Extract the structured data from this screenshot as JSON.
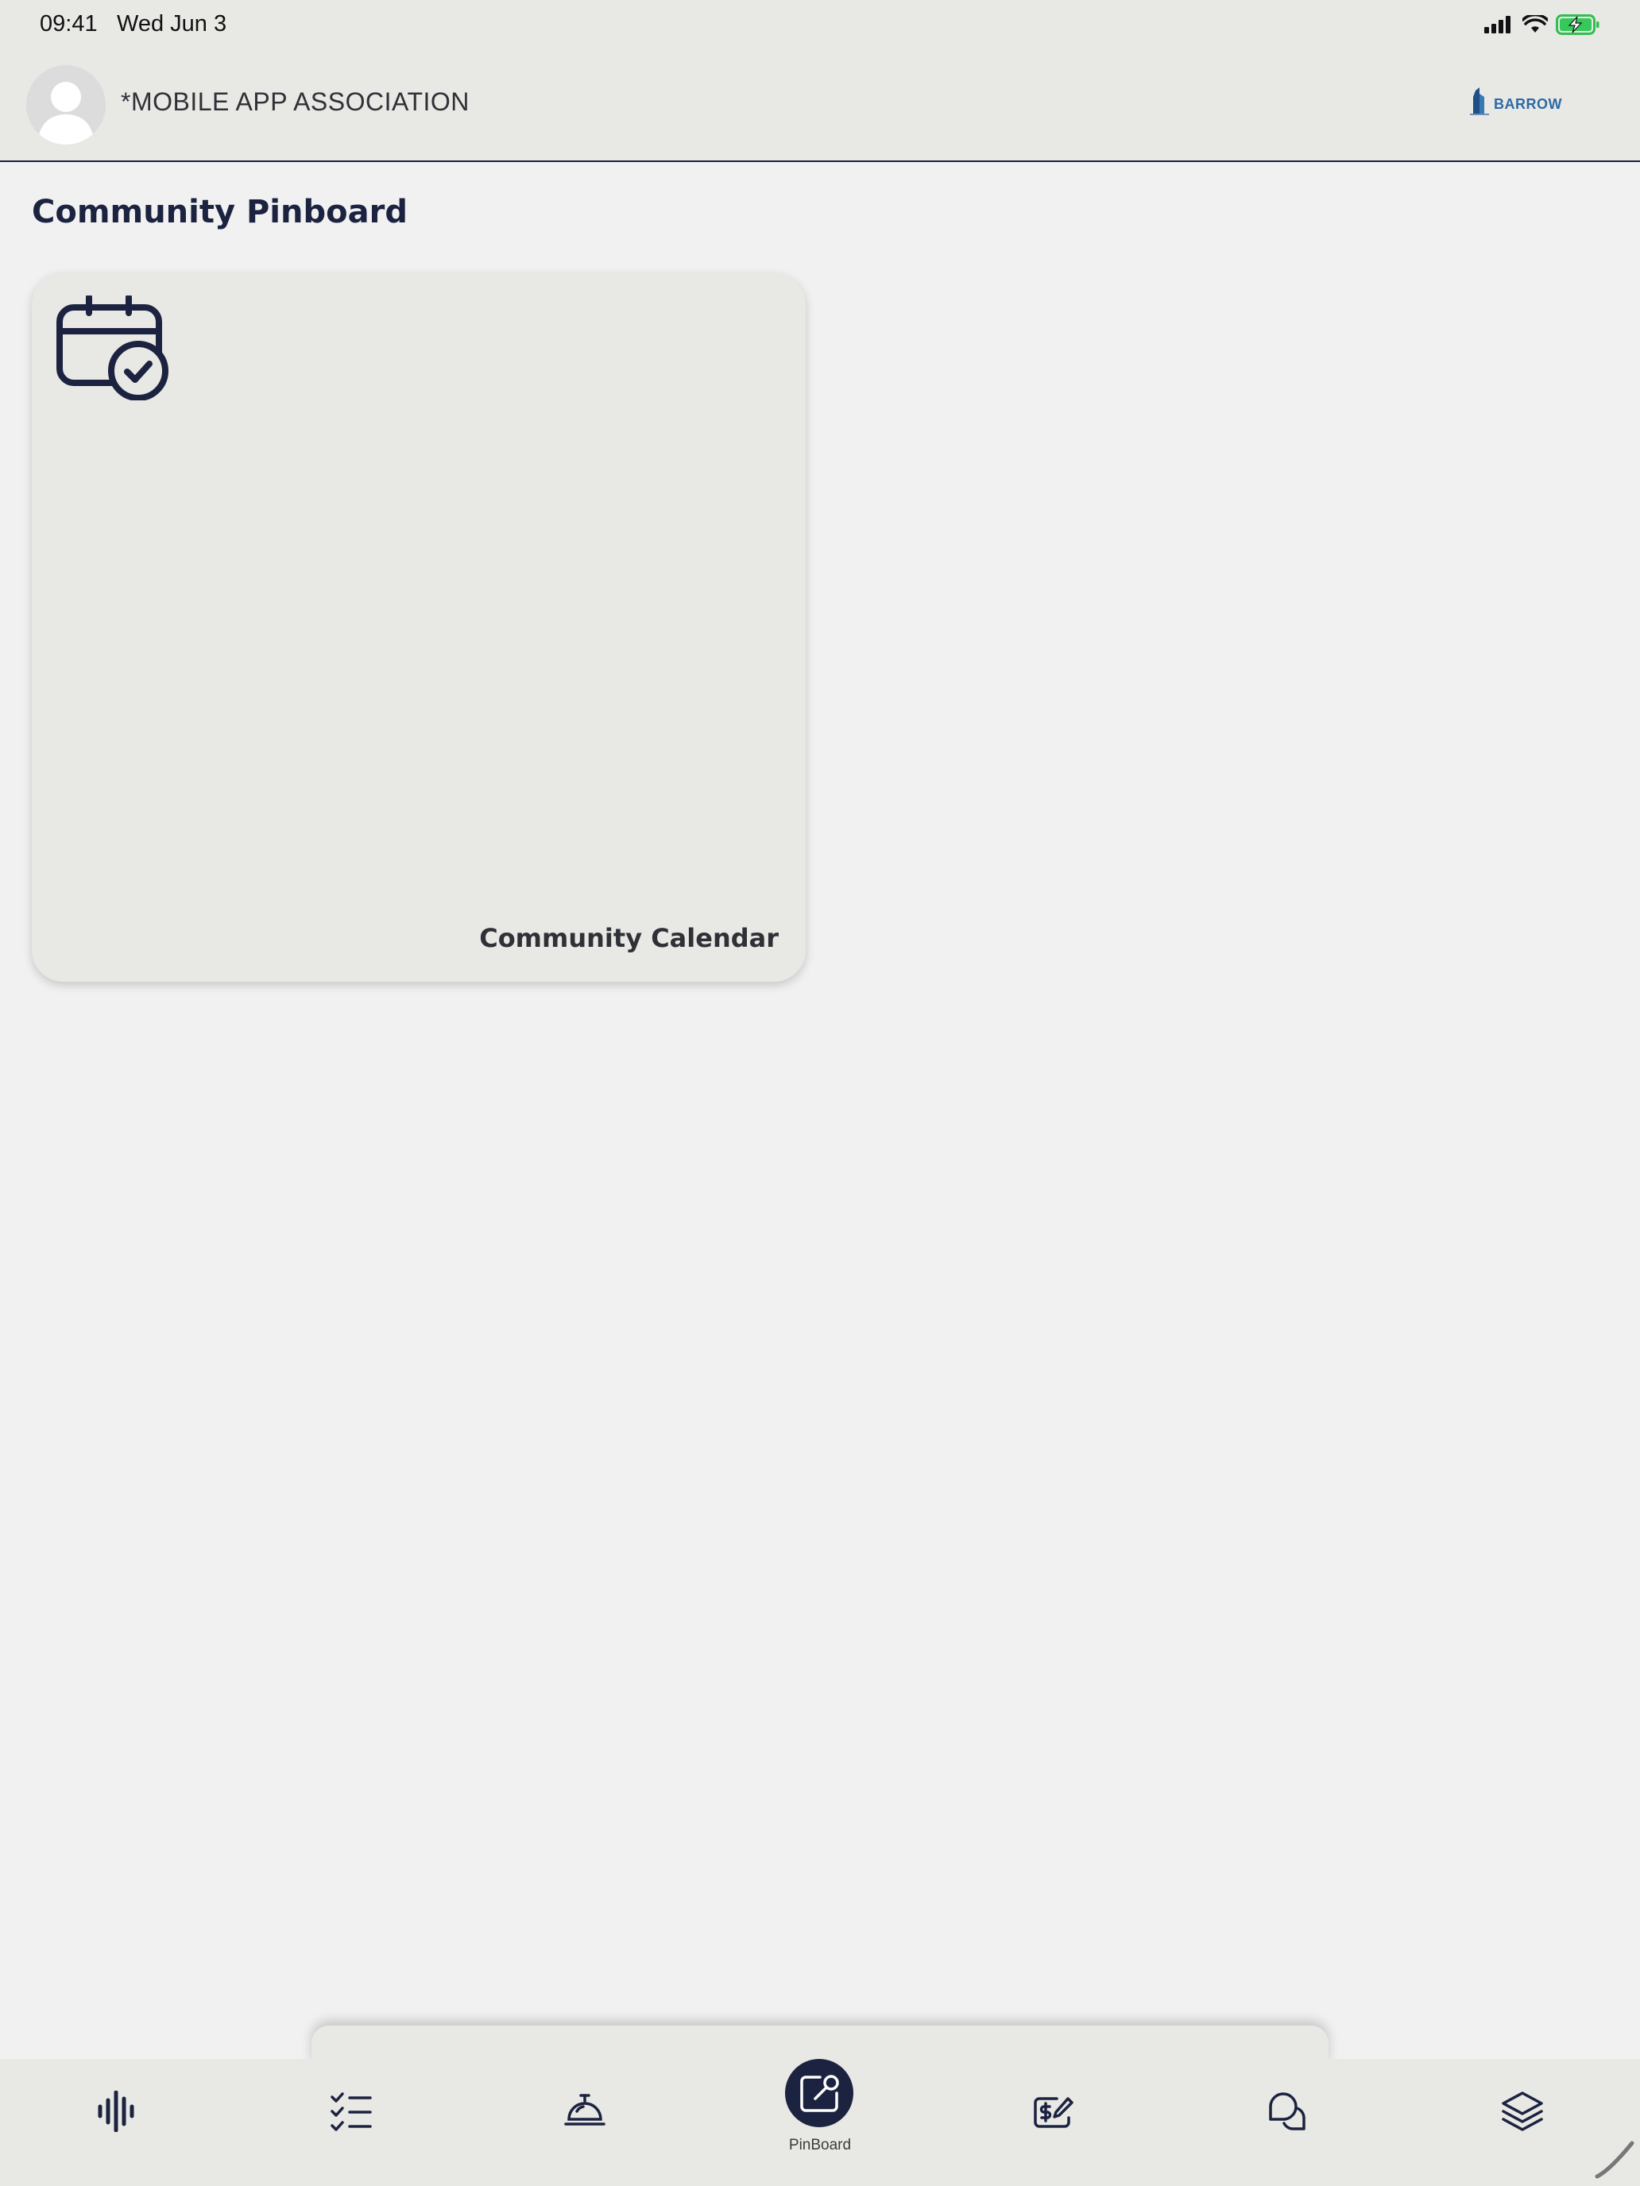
{
  "status_bar": {
    "time": "09:41",
    "date": "Wed Jun 3",
    "icons": [
      "cellular-signal-icon",
      "wifi-icon",
      "battery-charging-icon"
    ]
  },
  "header": {
    "org_name": "*MOBILE APP ASSOCIATION",
    "brand_logo_text": "BARROW",
    "avatar_icon": "user-silhouette-icon"
  },
  "main": {
    "title": "Community Pinboard",
    "cards": [
      {
        "label": "Community Calendar",
        "icon": "calendar-check-icon"
      }
    ]
  },
  "bottom_nav": {
    "items": [
      {
        "name": "audio-wave-icon",
        "label": ""
      },
      {
        "name": "checklist-icon",
        "label": ""
      },
      {
        "name": "concierge-bell-icon",
        "label": ""
      },
      {
        "name": "pinboard-icon",
        "label": "PinBoard",
        "active": true
      },
      {
        "name": "payment-edit-icon",
        "label": ""
      },
      {
        "name": "chat-bubbles-icon",
        "label": ""
      },
      {
        "name": "layers-icon",
        "label": ""
      }
    ]
  },
  "colors": {
    "primary": "#1c2340",
    "background": "#f1f1f1",
    "surface": "#e8e8e5",
    "brand_blue": "#2c6aa3"
  }
}
